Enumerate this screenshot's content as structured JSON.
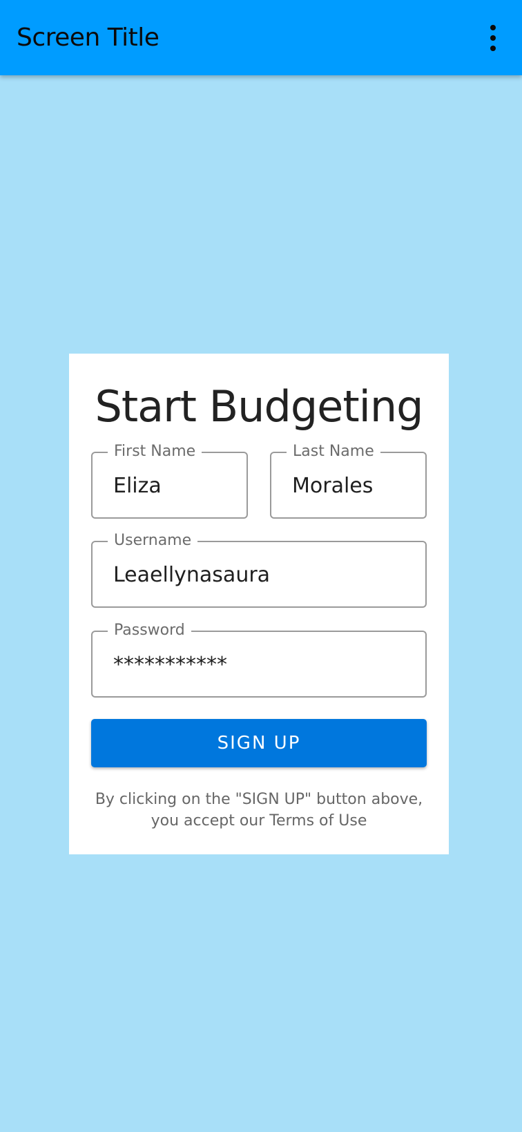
{
  "app_bar": {
    "title": "Screen Title",
    "menu_icon": "more-vert-icon",
    "background_color": "#009cff"
  },
  "page": {
    "background_color": "#a8dff8"
  },
  "signup_form": {
    "heading": "Start Budgeting",
    "first_name": {
      "label": "First Name",
      "value": "Eliza"
    },
    "last_name": {
      "label": "Last Name",
      "value": "Morales"
    },
    "username": {
      "label": "Username",
      "value": "Leaellynasaura"
    },
    "password": {
      "label": "Password",
      "value": "***********"
    },
    "submit_label": "SIGN UP",
    "submit_color": "#0077dd",
    "terms_line1": "By clicking on the \"SIGN UP\" button above,",
    "terms_line2": "you accept our Terms of Use"
  }
}
